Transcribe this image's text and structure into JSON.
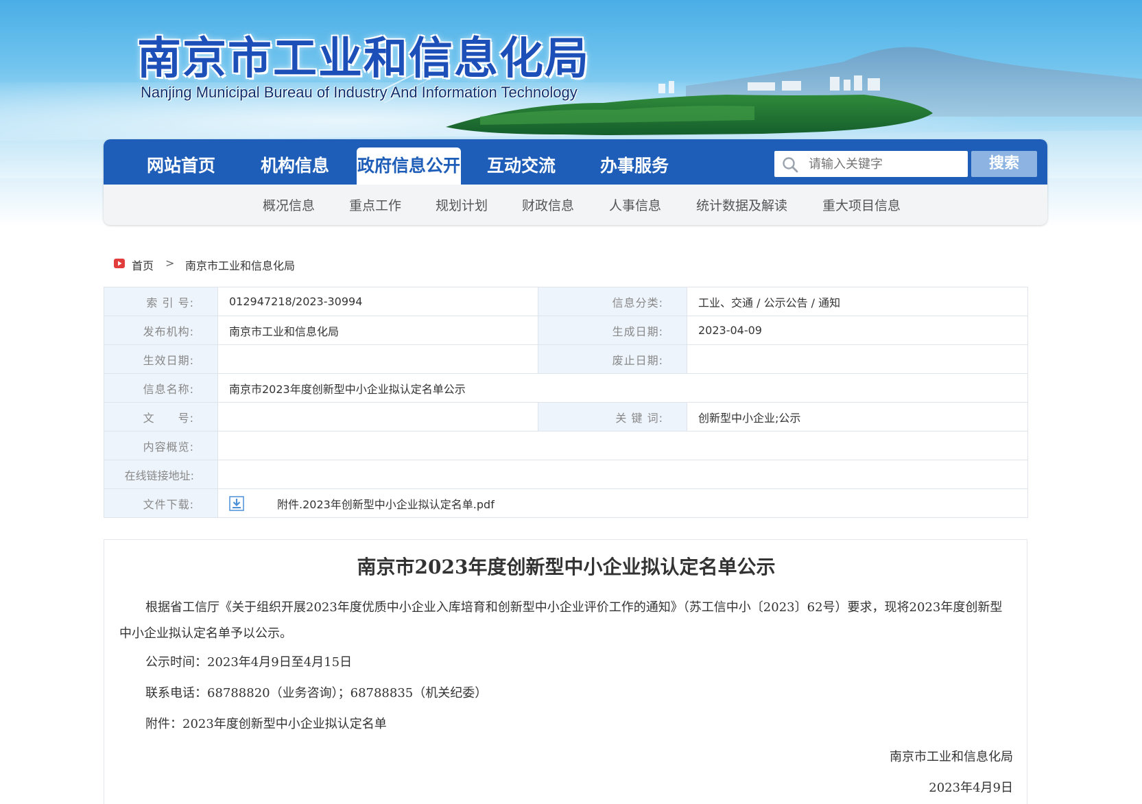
{
  "header": {
    "title_cn": "南京市工业和信息化局",
    "title_en": "Nanjing Municipal Bureau of Industry And Information Technology"
  },
  "nav": {
    "items": [
      {
        "label": "网站首页"
      },
      {
        "label": "机构信息"
      },
      {
        "label": "政府信息公开"
      },
      {
        "label": "互动交流"
      },
      {
        "label": "办事服务"
      }
    ],
    "active": "政府信息公开",
    "search_placeholder": "请输入关键字",
    "search_button": "搜索"
  },
  "subnav": {
    "items": [
      {
        "label": "概况信息"
      },
      {
        "label": "重点工作"
      },
      {
        "label": "规划计划"
      },
      {
        "label": "财政信息"
      },
      {
        "label": "人事信息"
      },
      {
        "label": "统计数据及解读"
      },
      {
        "label": "重大项目信息"
      }
    ]
  },
  "breadcrumb": {
    "home": "首页",
    "separator": ">",
    "current": "南京市工业和信息化局"
  },
  "meta": {
    "index_label": "索 引 号:",
    "index_value": "012947218/2023-30994",
    "category_label": "信息分类:",
    "category_value": "工业、交通 / 公示公告 / 通知",
    "publisher_label": "发布机构:",
    "publisher_value": "南京市工业和信息化局",
    "created_label": "生成日期:",
    "created_value": "2023-04-09",
    "effective_label": "生效日期:",
    "effective_value": "",
    "abolished_label": "废止日期:",
    "abolished_value": "",
    "name_label": "信息名称:",
    "name_value": "南京市2023年度创新型中小企业拟认定名单公示",
    "docno_label": "文　　号:",
    "docno_value": "",
    "keywords_label": "关 键 词:",
    "keywords_value": "创新型中小企业;公示",
    "summary_label": "内容概览:",
    "summary_value": "",
    "link_label": "在线链接地址:",
    "link_value": "",
    "download_label": "文件下载:",
    "download_value": "附件.2023年创新型中小企业拟认定名单.pdf"
  },
  "article": {
    "title": "南京市2023年度创新型中小企业拟认定名单公示",
    "p1": "根据省工信厅《关于组织开展2023年度优质中小企业入库培育和创新型中小企业评价工作的通知》（苏工信中小〔2023〕62号）要求，现将2023年度创新型中小企业拟认定名单予以公示。",
    "p2": "公示时间：2023年4月9日至4月15日",
    "p3": "联系电话：68788820（业务咨询）；68788835（机关纪委）",
    "p4": "附件：2023年度创新型中小企业拟认定名单",
    "signature": "南京市工业和信息化局",
    "date": "2023年4月9日"
  },
  "colors": {
    "nav_blue": "#1f5eb8",
    "title_blue": "#1d4fb8",
    "label_bg": "#eef4fc",
    "search_button_bg": "#8cb3e2"
  }
}
